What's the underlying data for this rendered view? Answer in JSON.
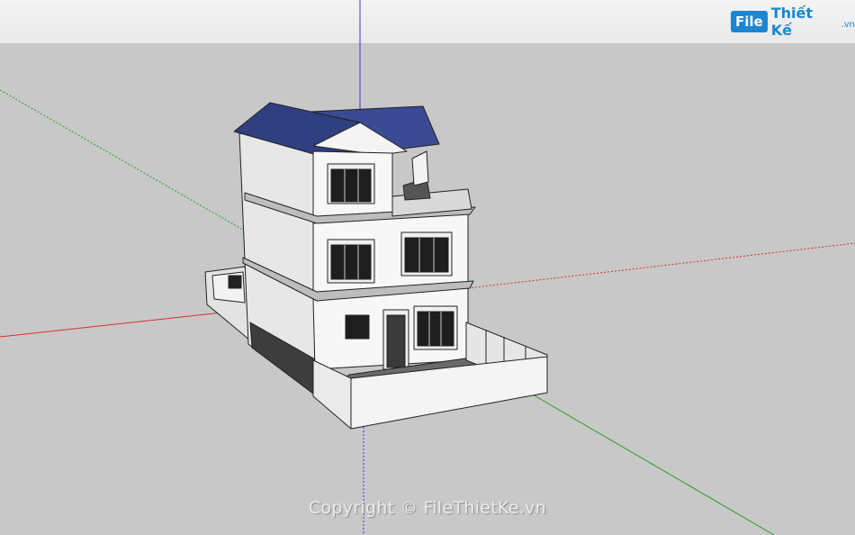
{
  "logo": {
    "box": "File",
    "text": "Thiết Kế",
    "tld": ".vn"
  },
  "watermark": {
    "text": "Copyright © FileThietKe.vn"
  },
  "colors": {
    "sky": "#eeeeee",
    "ground": "#c8c8c8",
    "roof": "#2f3f80",
    "wall": "#f7f7f7",
    "axis_red": "#d43030",
    "axis_green": "#24a024",
    "axis_blue": "#3a3ad0",
    "brand": "#1c86d1"
  },
  "icons": [
    "model-axes",
    "house-model"
  ]
}
